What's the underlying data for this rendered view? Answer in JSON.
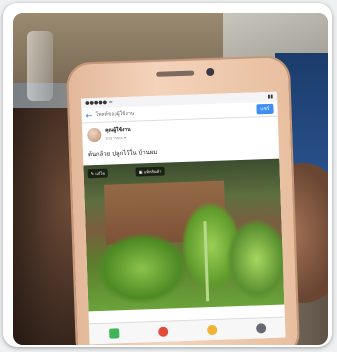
{
  "status_bar": {
    "left": "●●●●● ≈",
    "right": "▮▮"
  },
  "nav": {
    "back_symbol": "←",
    "title": "โพสต์ของผู้ใช้งาน",
    "post_label": "แชร์"
  },
  "author": {
    "name": "คุณผู้ใช้งาน",
    "sub": "สาธารณะ ▾"
  },
  "post_text": "ต้นกล้วย ปลูกไว้ใน บ้านผม",
  "image_chips": {
    "edit": "✎ แก้ไข",
    "tag": "▣ แท็กสินค้า"
  },
  "tabs": [
    {
      "icon": "photo-icon"
    },
    {
      "icon": "location-pin-icon"
    },
    {
      "icon": "emoji-icon"
    },
    {
      "icon": "more-icon"
    }
  ],
  "colors": {
    "phone_body": "#f4d3bb",
    "accent": "#3f8ef5"
  }
}
